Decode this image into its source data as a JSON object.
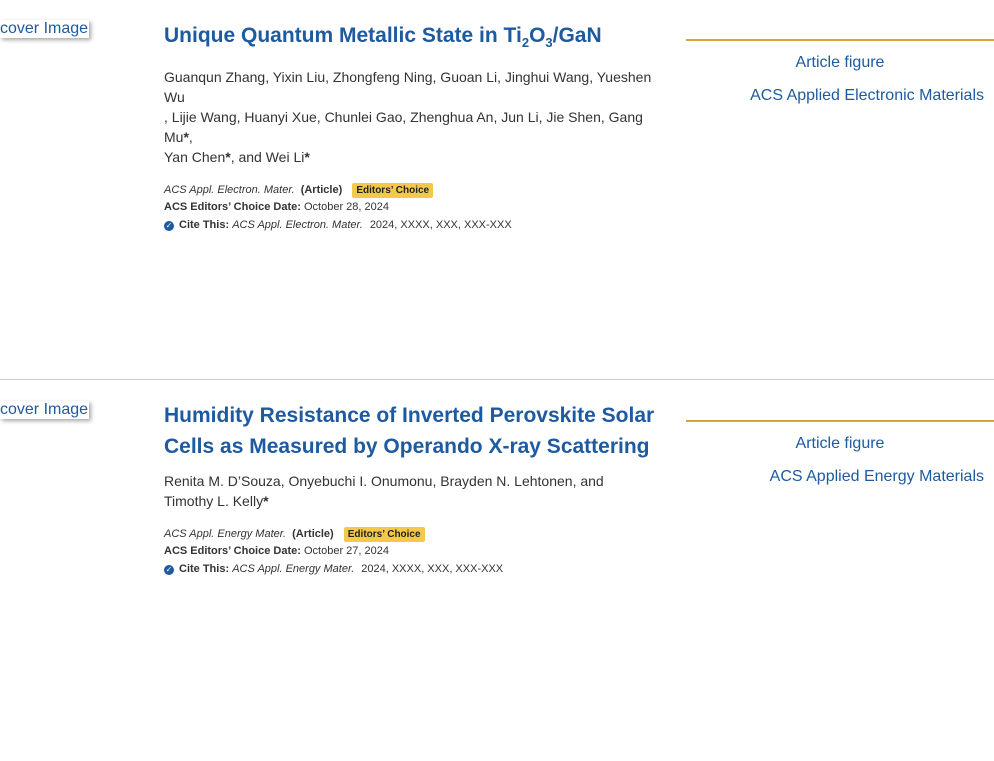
{
  "entries": [
    {
      "cover_alt": "cover Image",
      "title_parts": [
        "Unique Quantum Metallic State in Ti",
        "2",
        "O",
        "3",
        "/GaN"
      ],
      "authors_line1": "Guanqun Zhang, Yixin Liu, Zhongfeng Ning, Guoan Li, Jinghui Wang, Yueshen Wu",
      "authors_line2_pre": ", Lijie Wang, Huanyi Xue, Chunlei Gao, Zhenghua An, Jun Li, Jie Shen, Gang Mu",
      "authors_line3_pre": ", Yan Chen",
      "authors_line3_mid": ", and Wei Li",
      "star": "*",
      "journal_abbr": "ACS Appl. Electron. Mater.",
      "article_type": "(Article)",
      "badge": "Editors’ Choice",
      "choice_label": "ACS Editors’ Choice Date:",
      "choice_date": "October 28, 2024",
      "cite_label": "Cite This:",
      "cite_journal": "ACS Appl. Electron. Mater.",
      "cite_rest": "2024, XXXX, XXX, XXX-XXX",
      "figure_alt": "Article figure",
      "journal_cover_alt": "ACS Applied Electronic Materials"
    },
    {
      "cover_alt": "cover Image",
      "title": "Humidity Resistance of Inverted Perovskite Solar Cells as Measured by Operando X-ray Scattering",
      "authors_line1": "Renita M. D’Souza, Onyebuchi I. Onumonu, Brayden N. Lehtonen, and",
      "authors_line2": "Timothy L. Kelly",
      "star": "*",
      "journal_abbr": "ACS Appl. Energy Mater.",
      "article_type": "(Article)",
      "badge": "Editors’ Choice",
      "choice_label": "ACS Editors’ Choice Date:",
      "choice_date": "October 27, 2024",
      "cite_label": "Cite This:",
      "cite_journal": "ACS Appl. Energy Mater.",
      "cite_rest": "2024, XXXX, XXX, XXX-XXX",
      "figure_alt": "Article figure",
      "journal_cover_alt": "ACS Applied Energy Materials"
    }
  ],
  "icons": {
    "check": "verified-check-icon",
    "broken_image": "broken-image-icon"
  },
  "colors": {
    "link": "#1e5aa0",
    "badge": "#f3c94c",
    "rule": "#d8a437"
  }
}
